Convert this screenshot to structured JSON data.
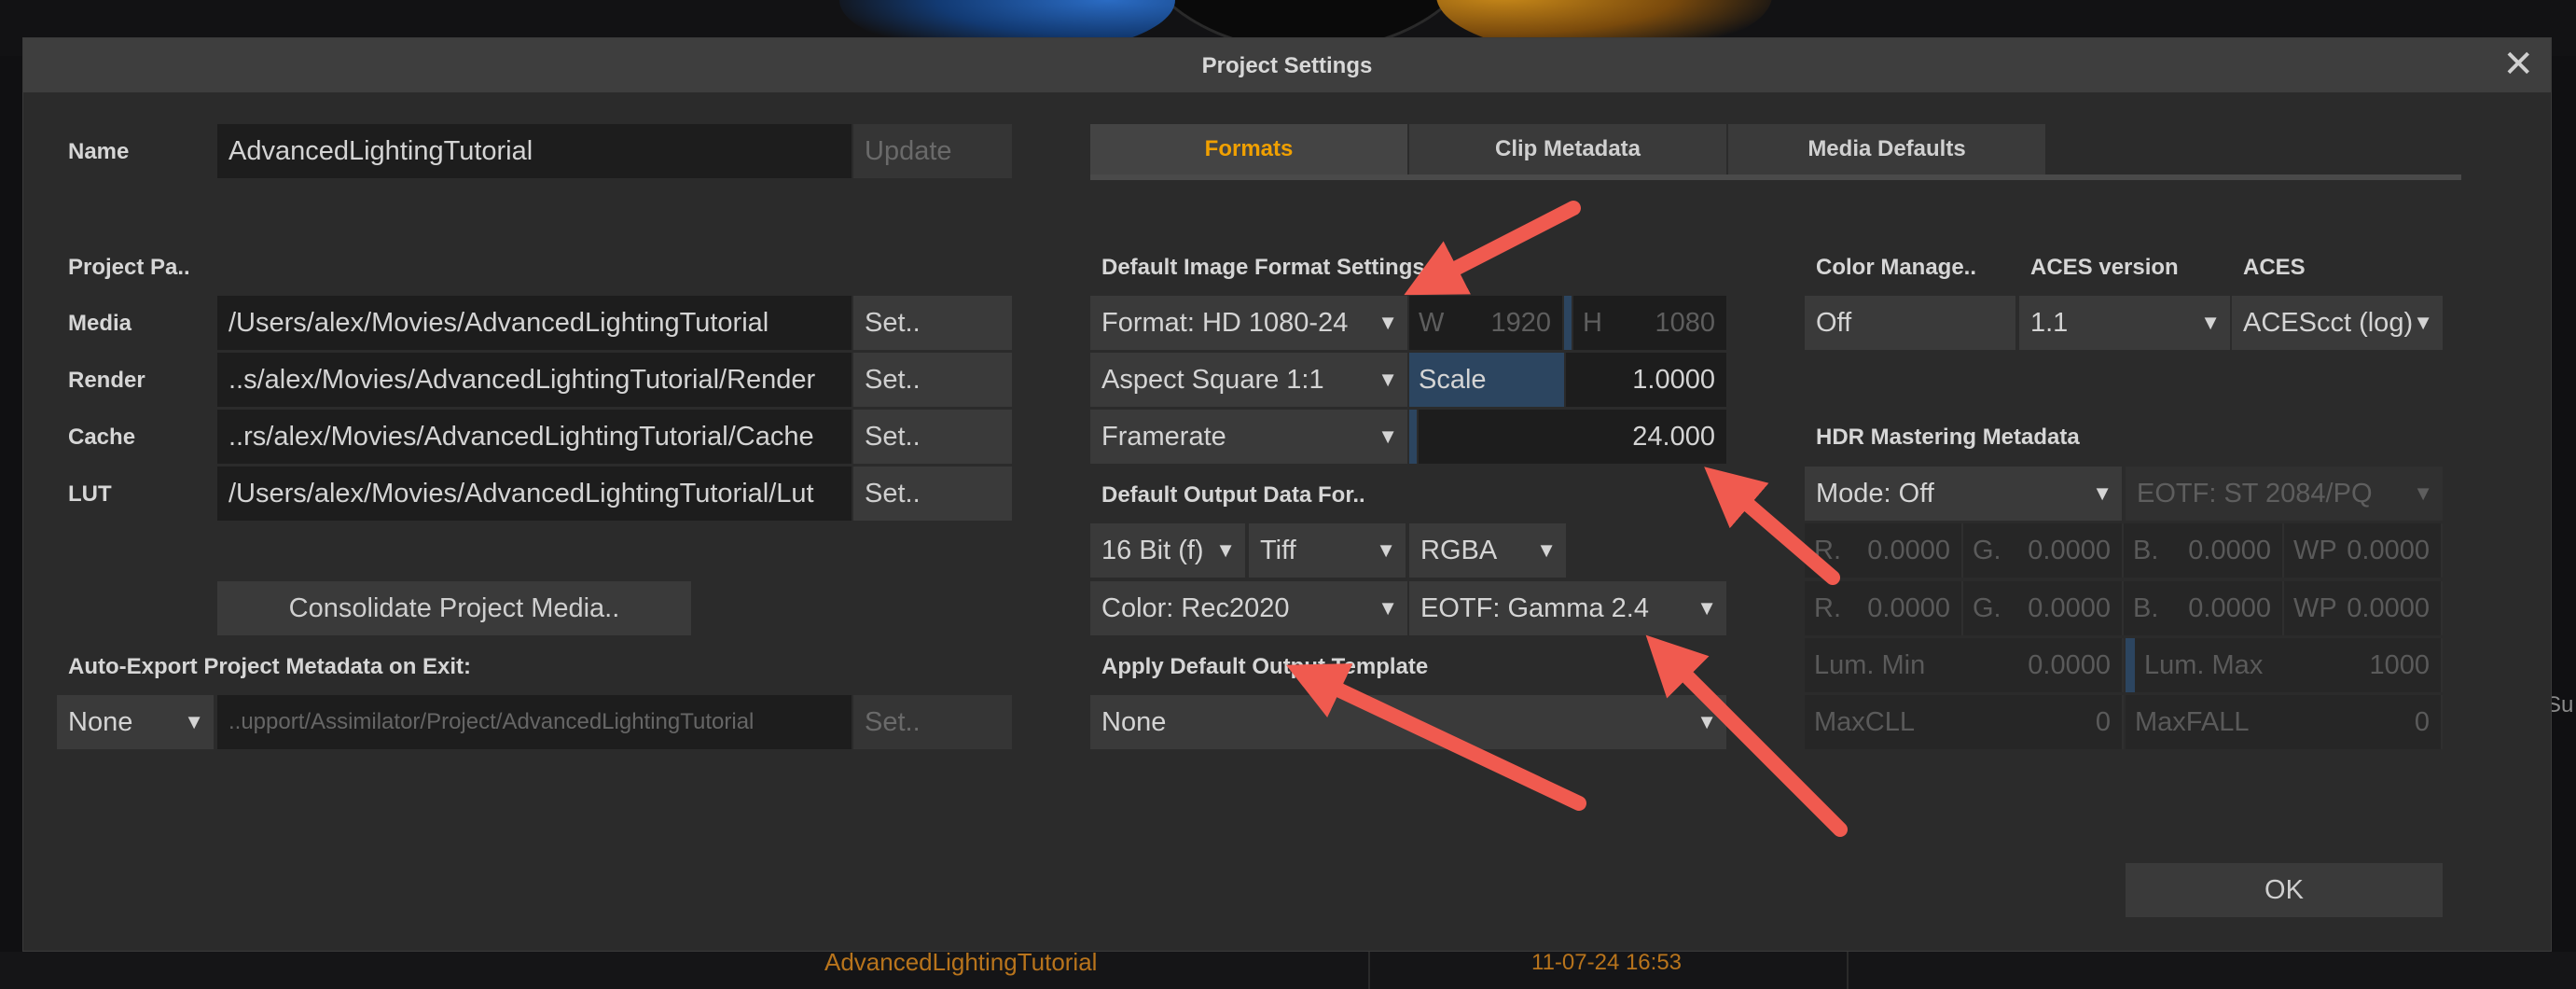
{
  "background": {
    "file_name": "AdvancedLightingTutorial",
    "file_date": "11-07-24 16:53",
    "side_text": "Su"
  },
  "dialog": {
    "title": "Project Settings",
    "close_glyph": "✕"
  },
  "left": {
    "name_label": "Name",
    "name_value": "AdvancedLightingTutorial",
    "update_button": "Update",
    "paths_header": "Project Pa..",
    "paths": [
      {
        "label": "Media",
        "value": "/Users/alex/Movies/AdvancedLightingTutorial",
        "button": "Set.."
      },
      {
        "label": "Render",
        "value": "..s/alex/Movies/AdvancedLightingTutorial/Render",
        "button": "Set.."
      },
      {
        "label": "Cache",
        "value": "..rs/alex/Movies/AdvancedLightingTutorial/Cache",
        "button": "Set.."
      },
      {
        "label": "LUT",
        "value": "/Users/alex/Movies/AdvancedLightingTutorial/Lut",
        "button": "Set.."
      }
    ],
    "consolidate_button": "Consolidate Project Media..",
    "auto_export_label": "Auto-Export Project Metadata on Exit:",
    "auto_export_select": "None",
    "auto_export_path": "..upport/Assimilator/Project/AdvancedLightingTutorial",
    "auto_export_button": "Set.."
  },
  "tabs": [
    {
      "label": "Formats",
      "active": true
    },
    {
      "label": "Clip Metadata",
      "active": false
    },
    {
      "label": "Media Defaults",
      "active": false
    }
  ],
  "formats": {
    "image_format_header": "Default Image Format Settings",
    "format_select": "Format: HD 1080-24",
    "w_label": "W",
    "w_value": "1920",
    "h_label": "H",
    "h_value": "1080",
    "aspect_select": "Aspect Square 1:1",
    "scale_label": "Scale",
    "scale_value": "1.0000",
    "framerate_select": "Framerate",
    "framerate_value": "24.000",
    "output_header": "Default Output Data For..",
    "bitdepth_select": "16 Bit (f)",
    "filetype_select": "Tiff",
    "channels_select": "RGBA",
    "color_select": "Color: Rec2020",
    "eotf_select": "EOTF: Gamma 2.4",
    "template_header": "Apply Default Output Template",
    "template_select": "None"
  },
  "color": {
    "cm_header": "Color Manage..",
    "aces_version_header": "ACES version",
    "aces_header": "ACES",
    "cm_select": "Off",
    "aces_version_select": "1.1",
    "aces_select": "ACEScct (log)"
  },
  "hdr": {
    "header": "HDR Mastering Metadata",
    "mode_select": "Mode: Off",
    "eotf_select": "EOTF: ST 2084/PQ",
    "row1": [
      {
        "k": "R.",
        "v": "0.0000"
      },
      {
        "k": "G.",
        "v": "0.0000"
      },
      {
        "k": "B.",
        "v": "0.0000"
      },
      {
        "k": "WP",
        "v": "0.0000"
      }
    ],
    "row2": [
      {
        "k": "R.",
        "v": "0.0000"
      },
      {
        "k": "G.",
        "v": "0.0000"
      },
      {
        "k": "B.",
        "v": "0.0000"
      },
      {
        "k": "WP",
        "v": "0.0000"
      }
    ],
    "lum_min_label": "Lum. Min",
    "lum_min_value": "0.0000",
    "lum_max_label": "Lum. Max",
    "lum_max_value": "1000",
    "maxcll_label": "MaxCLL",
    "maxcll_value": "0",
    "maxfall_label": "MaxFALL",
    "maxfall_value": "0"
  },
  "ok_button": "OK",
  "colors": {
    "accent": "#f0a000",
    "annotation_arrow": "#f05a4f"
  }
}
